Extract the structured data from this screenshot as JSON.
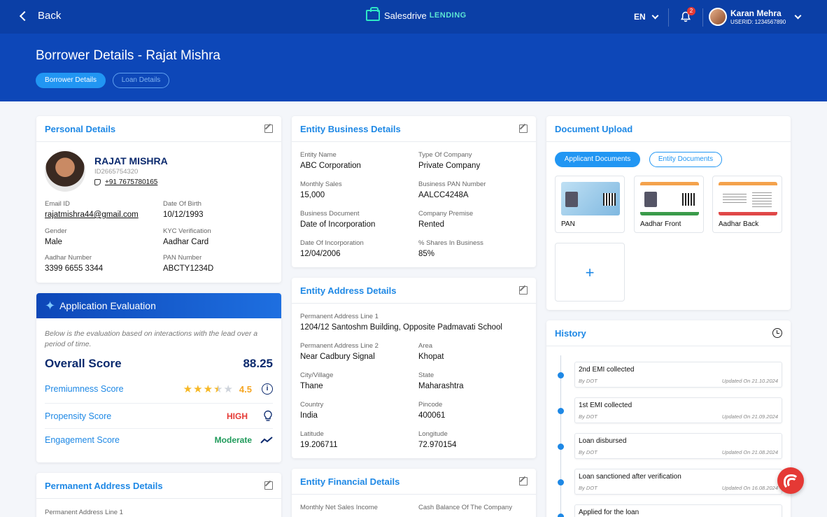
{
  "topbar": {
    "back_label": "Back",
    "brand_name": "Salesdrive",
    "brand_suffix": "LENDING",
    "language": "EN",
    "notification_count": "2",
    "user_name": "Karan Mehra",
    "user_id": "USERID: 1234567890"
  },
  "header": {
    "title": "Borrower Details - Rajat Mishra",
    "tabs": [
      {
        "label": "Borrower Details",
        "active": true
      },
      {
        "label": "Loan Details",
        "active": false
      }
    ]
  },
  "personal": {
    "title": "Personal Details",
    "name": "RAJAT MISHRA",
    "id": "ID2665754320",
    "phone": "+91 7675780165",
    "fields": [
      {
        "label": "Email ID",
        "value": "rajatmishra44@gmail.com"
      },
      {
        "label": "Date Of Birth",
        "value": "10/12/1993"
      },
      {
        "label": "Gender",
        "value": "Male"
      },
      {
        "label": "KYC Verification",
        "value": "Aadhar Card"
      },
      {
        "label": "Aadhar Number",
        "value": "3399 6655 3344"
      },
      {
        "label": "PAN Number",
        "value": "ABCTY1234D"
      }
    ]
  },
  "evaluation": {
    "title": "Application Evaluation",
    "description": "Below is the evaluation based on interactions with the lead over a period of time.",
    "overall_label": "Overall Score",
    "overall_value": "88.25",
    "premiumness_label": "Premiumness Score",
    "premiumness_value": "4.5",
    "propensity_label": "Propensity Score",
    "propensity_value": "HIGH",
    "engagement_label": "Engagement Score",
    "engagement_value": "Moderate"
  },
  "permanent_address": {
    "title": "Permanent Address Details",
    "line1_label": "Permanent Address Line 1"
  },
  "entity_business": {
    "title": "Entity Business Details",
    "fields": [
      {
        "label": "Entity Name",
        "value": "ABC Corporation"
      },
      {
        "label": "Type Of Company",
        "value": "Private Company"
      },
      {
        "label": "Monthly Sales",
        "value": "15,000"
      },
      {
        "label": "Business PAN Number",
        "value": "AALCC4248A"
      },
      {
        "label": "Business Document",
        "value": "Date of Incorporation"
      },
      {
        "label": "Company Premise",
        "value": "Rented"
      },
      {
        "label": "Date Of Incorporation",
        "value": "12/04/2006"
      },
      {
        "label": "% Shares In Business",
        "value": "85%"
      }
    ]
  },
  "entity_address": {
    "title": "Entity Address Details",
    "fields": [
      {
        "label": "Permanent Address Line 1",
        "value": "1204/12 Santoshm Building, Opposite Padmavati School"
      },
      {
        "label": "Permanent Address Line 2",
        "value": "Near Cadbury Signal"
      },
      {
        "label": "Area",
        "value": "Khopat"
      },
      {
        "label": "City/Village",
        "value": "Thane"
      },
      {
        "label": "State",
        "value": "Maharashtra"
      },
      {
        "label": "Country",
        "value": "India"
      },
      {
        "label": "Pincode",
        "value": "400061"
      },
      {
        "label": "Latitude",
        "value": "19.206711"
      },
      {
        "label": "Longitude",
        "value": "72.970154"
      }
    ]
  },
  "entity_financial": {
    "title": "Entity Financial Details",
    "fields": [
      {
        "label": "Monthly Net Sales Income"
      },
      {
        "label": "Cash Balance Of The Company"
      }
    ]
  },
  "documents": {
    "title": "Document Upload",
    "tabs": [
      {
        "label": "Applicant Documents",
        "active": true
      },
      {
        "label": "Entity Documents",
        "active": false
      }
    ],
    "items": [
      {
        "label": "PAN"
      },
      {
        "label": "Aadhar Front"
      },
      {
        "label": "Aadhar Back"
      }
    ],
    "add_label": "+"
  },
  "history": {
    "title": "History",
    "items": [
      {
        "title": "2nd EMI collected",
        "by": "By DOT",
        "date": "Updated On 21.10.2024"
      },
      {
        "title": "1st EMI collected",
        "by": "By DOT",
        "date": "Updated On 21.09.2024"
      },
      {
        "title": "Loan disbursed",
        "by": "By DOT",
        "date": "Updated On 21.08.2024"
      },
      {
        "title": "Loan sanctioned after verification",
        "by": "By DOT",
        "date": "Updated On 16.08.2024"
      },
      {
        "title": "Applied for the loan"
      }
    ]
  },
  "colors": {
    "topbar": "#0b3fa6",
    "band": "#0d47b8",
    "accent": "#1e88e5",
    "high": "#e53935",
    "moderate": "#1f9a5a",
    "star": "#f6b825"
  }
}
